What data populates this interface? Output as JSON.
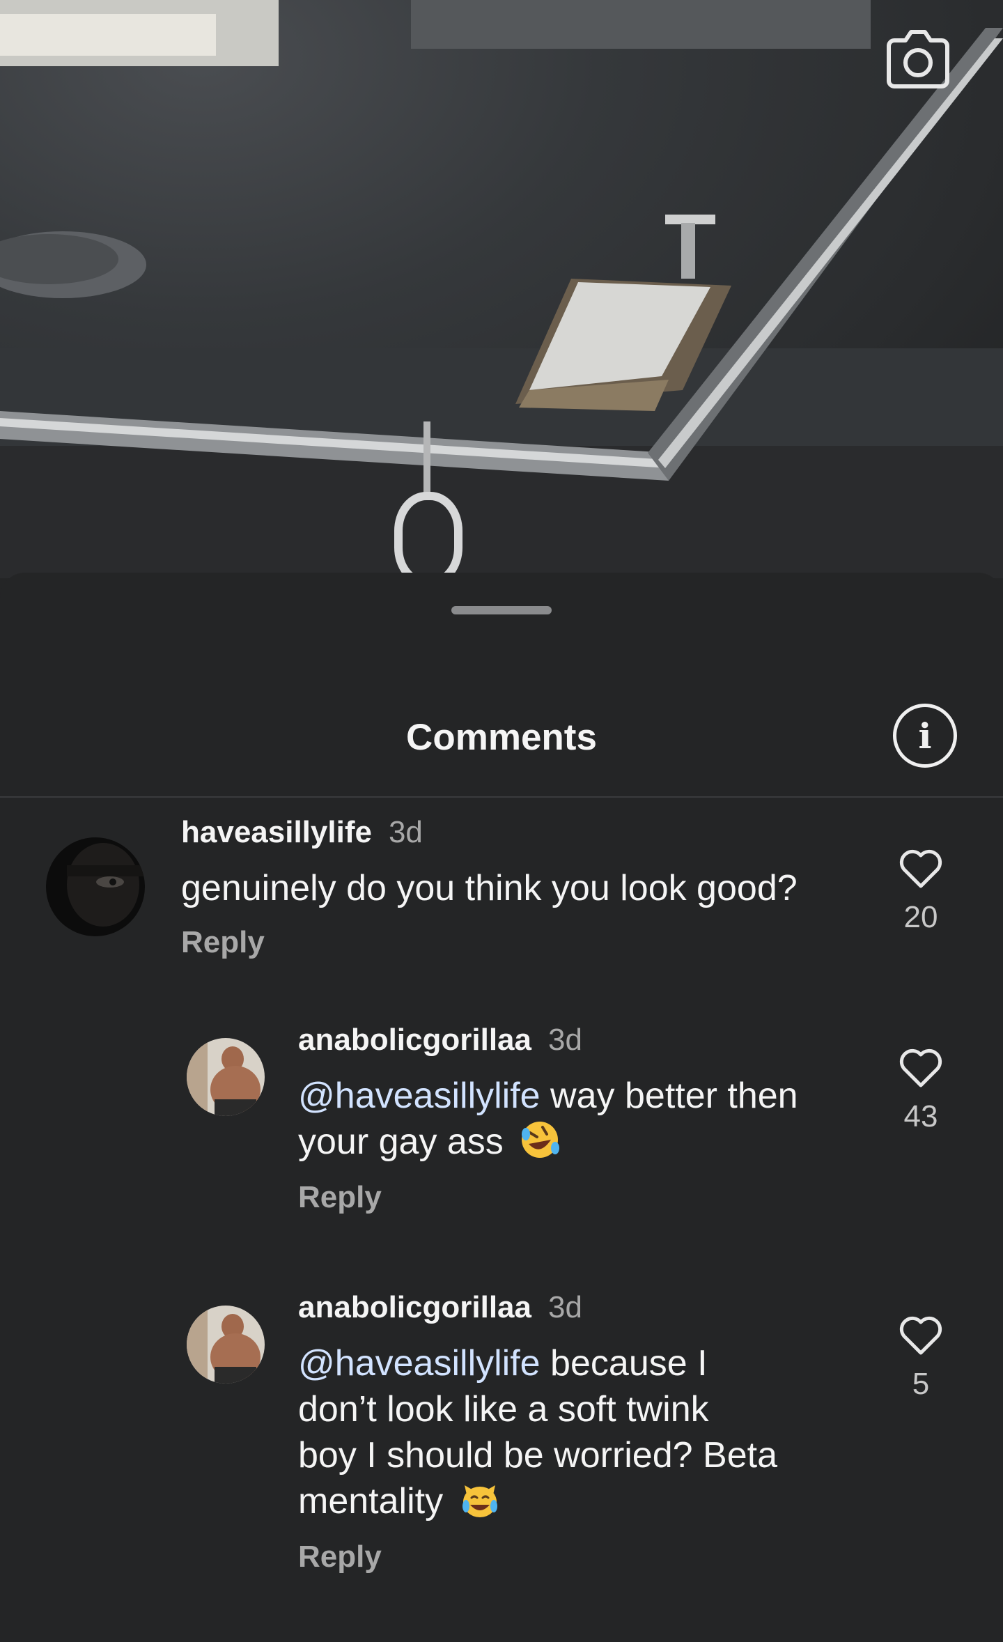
{
  "photo": {
    "camera_icon": "camera-icon"
  },
  "sheet": {
    "title": "Comments",
    "info_icon": "info-icon",
    "info_glyph": "i"
  },
  "comments": [
    {
      "username": "haveasillylife",
      "time": "3d",
      "text": "genuinely do you think you look good?",
      "reply_label": "Reply",
      "likes": "20"
    },
    {
      "username": "anabolicgorillaa",
      "time": "3d",
      "mention": "@haveasillylife",
      "text_line1": " way better then",
      "text_line2": "your gay ass",
      "emoji": "rolling-on-floor-laughing-emoji",
      "reply_label": "Reply",
      "likes": "43"
    },
    {
      "username": "anabolicgorillaa",
      "time": "3d",
      "mention": "@haveasillylife",
      "text_line1": " because I",
      "text_line2": "don’t look like a soft twink",
      "text_line3": "boy I should be worried? Beta",
      "text_line4": "mentality",
      "emoji": "cat-with-tears-of-joy-emoji",
      "reply_label": "Reply",
      "likes": "5"
    }
  ]
}
